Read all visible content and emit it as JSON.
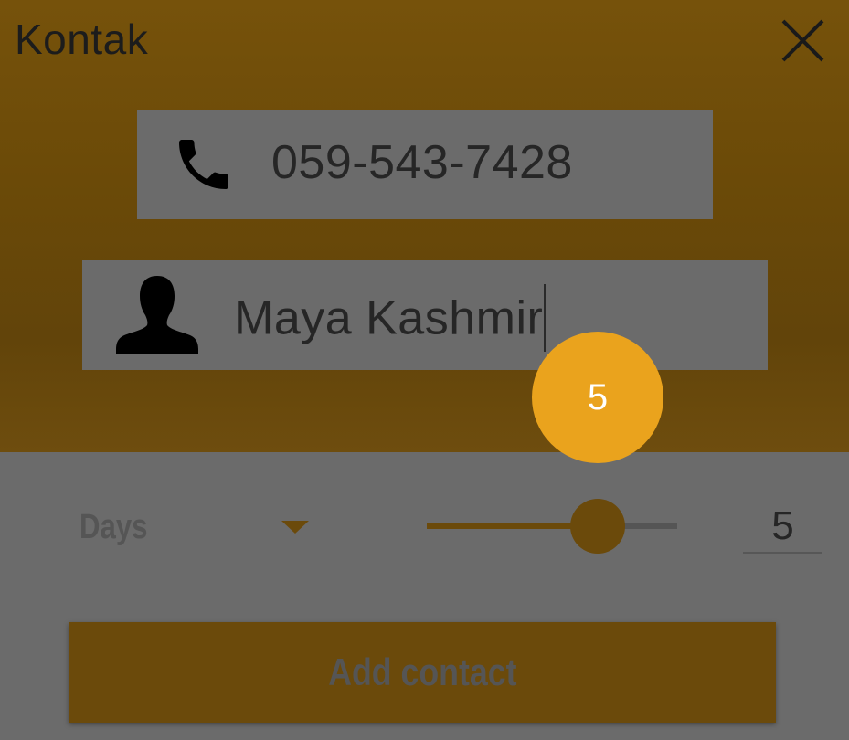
{
  "header": {
    "title": "Kontak",
    "close_icon": "close-icon"
  },
  "form": {
    "phone": {
      "icon": "phone-icon",
      "value": "059-543-7428"
    },
    "name": {
      "icon": "person-icon",
      "value": "Maya Kashmir"
    }
  },
  "badge": {
    "value": "5",
    "color": "#eaa31d"
  },
  "duration": {
    "unit_label": "Days",
    "dropdown_icon": "chevron-down-icon",
    "slider_fraction": 0.68,
    "value": "5"
  },
  "actions": {
    "add_contact_label": "Add contact"
  },
  "colors": {
    "accent": "#6b4a0b",
    "panel": "#6b6b6b",
    "badge": "#eaa31d"
  }
}
